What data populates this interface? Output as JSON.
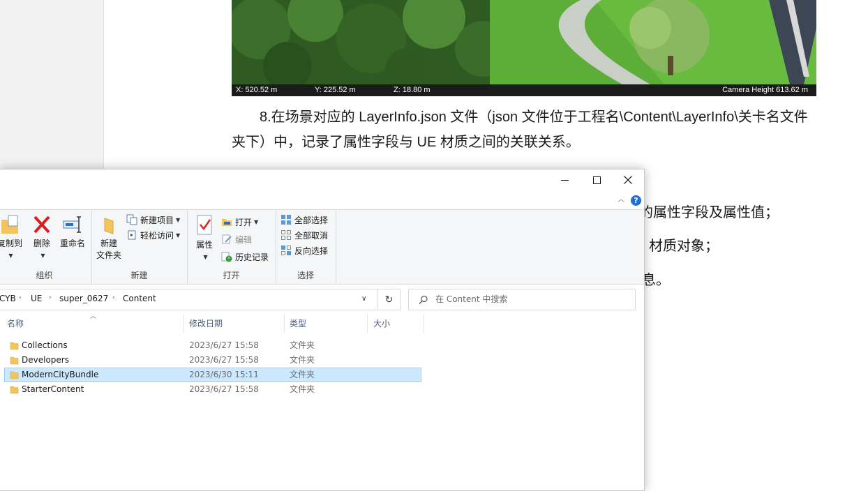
{
  "document": {
    "scene_status": {
      "x": "X: 520.52 m",
      "y": "Y: 225.52 m",
      "z": "Z: 18.80 m",
      "camera_height": "Camera Height  613.62 m"
    },
    "paragraph": "8.在场景对应的 LayerInfo.json 文件（json 文件位于工程名\\Content\\LayerInfo\\关卡名文件夹下）中，记录了属性字段与 UE 材质之间的关联关系。",
    "line2": "的属性字段及属性值；",
    "line3": "材质对象；",
    "line4": "息。"
  },
  "explorer": {
    "ribbon": {
      "organize": {
        "label": "组织",
        "copy_to": "复制到",
        "delete": "删除",
        "rename": "重命名"
      },
      "new": {
        "label": "新建",
        "new_folder_line1": "新建",
        "new_folder_line2": "文件夹",
        "new_item": "新建项目",
        "easy_access": "轻松访问"
      },
      "open": {
        "label": "打开",
        "properties": "属性",
        "open": "打开",
        "edit": "编辑",
        "history": "历史记录"
      },
      "select": {
        "label": "选择",
        "select_all": "全部选择",
        "select_none": "全部取消",
        "invert": "反向选择"
      }
    },
    "address": {
      "crumbs": [
        "CYB",
        "UE",
        "super_0627",
        "Content"
      ]
    },
    "search": {
      "placeholder": "在 Content 中搜索"
    },
    "columns": {
      "name": "名称",
      "modified": "修改日期",
      "type": "类型",
      "size": "大小"
    },
    "files": [
      {
        "name": "Collections",
        "modified": "2023/6/27 15:58",
        "type": "文件夹",
        "selected": false
      },
      {
        "name": "Developers",
        "modified": "2023/6/27 15:58",
        "type": "文件夹",
        "selected": false
      },
      {
        "name": "ModernCityBundle",
        "modified": "2023/6/30 15:11",
        "type": "文件夹",
        "selected": true
      },
      {
        "name": "StarterContent",
        "modified": "2023/6/27 15:58",
        "type": "文件夹",
        "selected": false
      }
    ],
    "colors": {
      "selection_bg": "#cce8ff",
      "selection_border": "#99d1ff",
      "folder": "#f2c55c",
      "accent": "#1e6fd0",
      "delete": "#d81e1e"
    }
  }
}
